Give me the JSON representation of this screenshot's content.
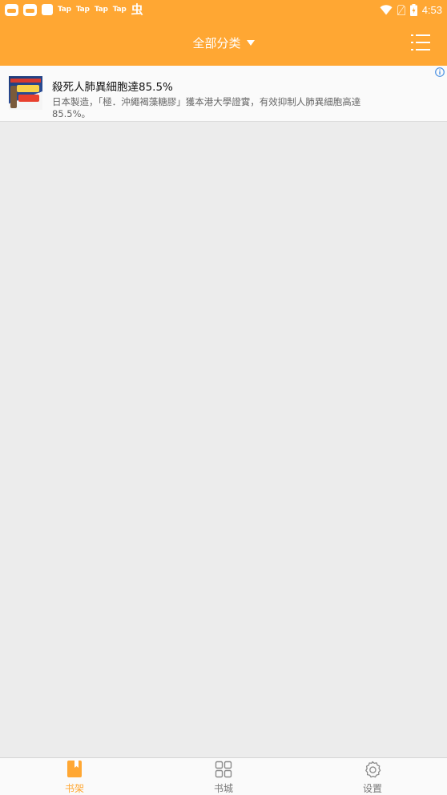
{
  "status_bar": {
    "tap_labels": [
      "Tap",
      "Tap",
      "Tap",
      "Tap"
    ],
    "bug_glyph": "虫",
    "time": "4:53",
    "icons": [
      "app-robot-icon",
      "app-robot-icon",
      "app-square-icon",
      "bug-icon",
      "wifi-icon",
      "no-sim-icon",
      "battery-icon"
    ]
  },
  "toolbar": {
    "category_label": "全部分类",
    "menu_icon": "list-menu-icon",
    "background_color": "#ffa733"
  },
  "ad": {
    "title": "殺死人肺異細胞達85.5%",
    "description": "日本製造，「極．沖繩褐藻糖膠」獲本港大學證實，有效抑制人肺異細胞高達85.5%。",
    "info_icon": "ad-info-icon"
  },
  "bottom_nav": {
    "tabs": [
      {
        "label": "书架",
        "icon": "bookshelf-icon",
        "active": true
      },
      {
        "label": "书城",
        "icon": "grid-store-icon",
        "active": false
      },
      {
        "label": "设置",
        "icon": "settings-gear-icon",
        "active": false
      }
    ],
    "active_color": "#ffa733",
    "inactive_color": "#777777"
  }
}
